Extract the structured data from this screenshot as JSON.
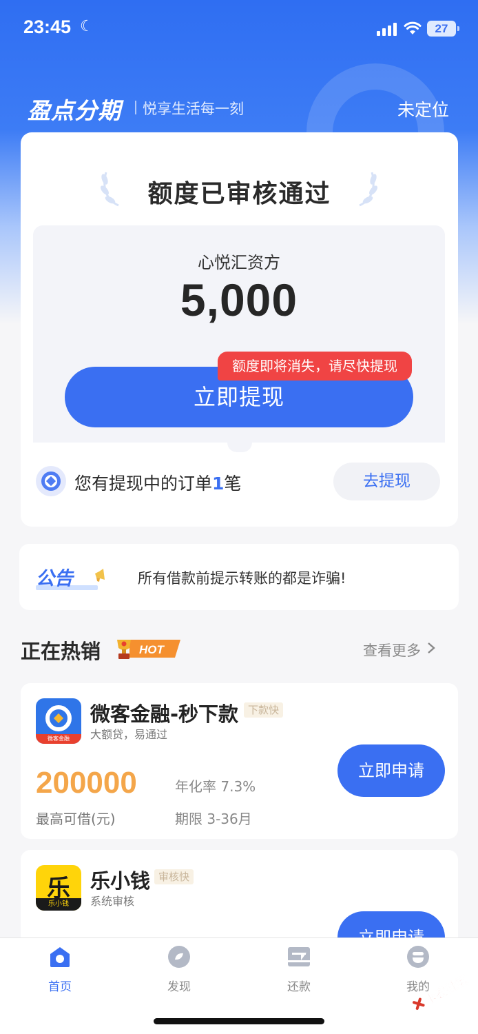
{
  "status_bar": {
    "time": "23:45",
    "battery": "27"
  },
  "header": {
    "brand": "盈点分期",
    "slogan": "悦享生活每一刻",
    "location": "未定位"
  },
  "credit_card": {
    "title": "额度已审核通过",
    "funder": "心悦汇资方",
    "amount": "5,000",
    "warning": "额度即将消失，请尽快提现",
    "withdraw_label": "立即提现",
    "order_prefix": "您有提现中的订单",
    "order_count": "1",
    "order_suffix": "笔",
    "go_withdraw_label": "去提现"
  },
  "notice": {
    "badge": "公告",
    "text": "所有借款前提示转账的都是诈骗!"
  },
  "hot_section": {
    "title": "正在热销",
    "badge": "HOT",
    "more_label": "查看更多"
  },
  "products": [
    {
      "name": "微客金融-秒下款",
      "tag": "下款快",
      "subtitle": "大额贷，易通过",
      "logo_text": "微客金融",
      "max_amount": "200000",
      "max_label": "最高可借(元)",
      "rate": "年化率 7.3%",
      "term": "期限 3-36月",
      "apply_label": "立即申请"
    },
    {
      "name": "乐小钱",
      "tag": "审核快",
      "subtitle": "系统审核",
      "logo_glyph": "乐",
      "logo_text": "乐小钱",
      "apply_label": "立即申请"
    }
  ],
  "tabbar": {
    "items": [
      {
        "label": "首页",
        "icon": "home-icon",
        "active": true
      },
      {
        "label": "发现",
        "icon": "discover-icon",
        "active": false
      },
      {
        "label": "还款",
        "icon": "repay-icon",
        "active": false
      },
      {
        "label": "我的",
        "icon": "profile-icon",
        "active": false
      }
    ]
  },
  "watermark": "卡农社区",
  "colors": {
    "primary": "#3a6ff2",
    "warning": "#f04444",
    "amount_orange": "#f4a64a"
  }
}
